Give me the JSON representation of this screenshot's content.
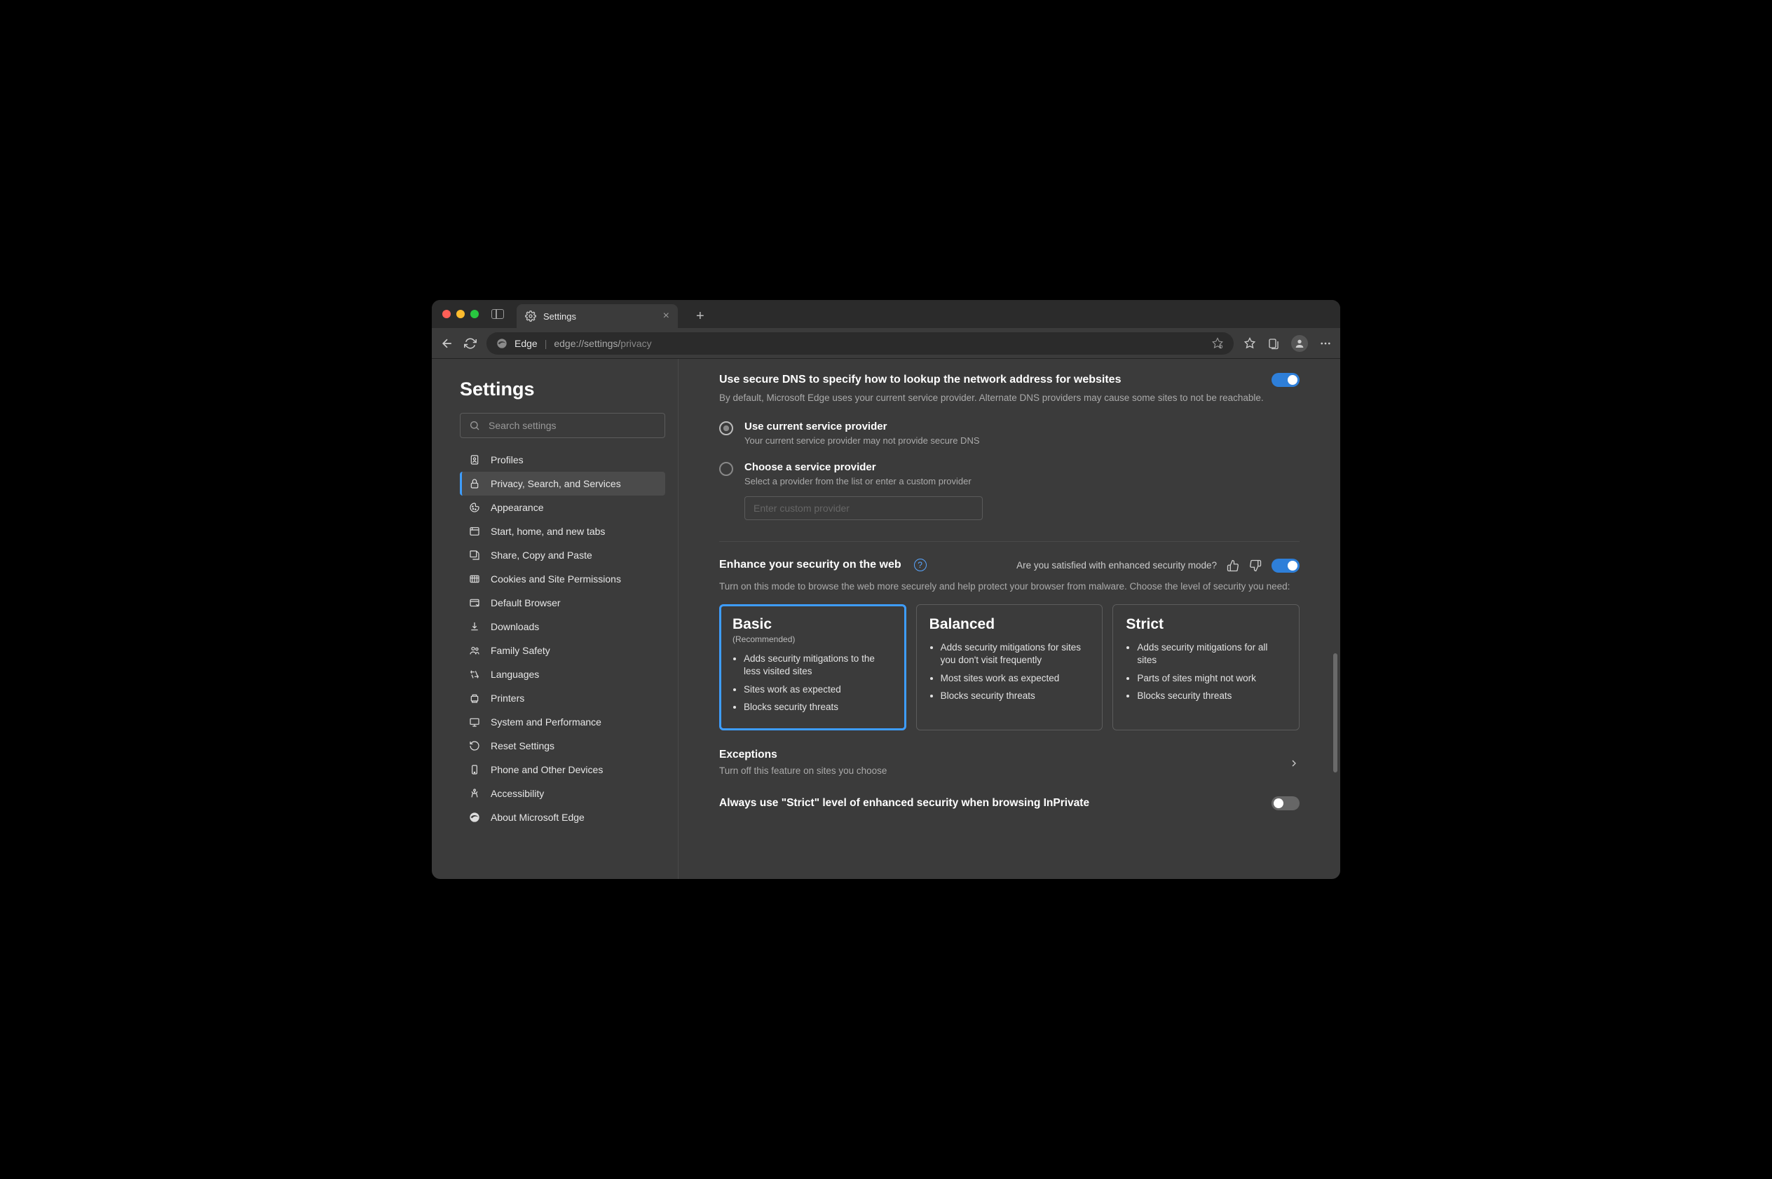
{
  "titlebar": {
    "tab_title": "Settings"
  },
  "toolbar": {
    "brand": "Edge",
    "url_pre": "edge://settings/",
    "url_suf": "privacy"
  },
  "sidebar": {
    "title": "Settings",
    "search_placeholder": "Search settings",
    "items": [
      {
        "label": "Profiles"
      },
      {
        "label": "Privacy, Search, and Services"
      },
      {
        "label": "Appearance"
      },
      {
        "label": "Start, home, and new tabs"
      },
      {
        "label": "Share, Copy and Paste"
      },
      {
        "label": "Cookies and Site Permissions"
      },
      {
        "label": "Default Browser"
      },
      {
        "label": "Downloads"
      },
      {
        "label": "Family Safety"
      },
      {
        "label": "Languages"
      },
      {
        "label": "Printers"
      },
      {
        "label": "System and Performance"
      },
      {
        "label": "Reset Settings"
      },
      {
        "label": "Phone and Other Devices"
      },
      {
        "label": "Accessibility"
      },
      {
        "label": "About Microsoft Edge"
      }
    ]
  },
  "dns": {
    "heading": "Use secure DNS to specify how to lookup the network address for websites",
    "sub": "By default, Microsoft Edge uses your current service provider. Alternate DNS providers may cause some sites to not be reachable.",
    "opt1": "Use current service provider",
    "opt1_sub": "Your current service provider may not provide secure DNS",
    "opt2": "Choose a service provider",
    "opt2_sub": "Select a provider from the list or enter a custom provider",
    "custom_placeholder": "Enter custom provider"
  },
  "enhance": {
    "heading": "Enhance your security on the web",
    "feedback_q": "Are you satisfied with enhanced security mode?",
    "sub": "Turn on this mode to browse the web more securely and help protect your browser from malware. Choose the level of security you need:",
    "cards": [
      {
        "title": "Basic",
        "rec": "(Recommended)",
        "bullets": [
          "Adds security mitigations to the less visited sites",
          "Sites work as expected",
          "Blocks security threats"
        ]
      },
      {
        "title": "Balanced",
        "bullets": [
          "Adds security mitigations for sites you don't visit frequently",
          "Most sites work as expected",
          "Blocks security threats"
        ]
      },
      {
        "title": "Strict",
        "bullets": [
          "Adds security mitigations for all sites",
          "Parts of sites might not work",
          "Blocks security threats"
        ]
      }
    ],
    "exceptions": "Exceptions",
    "exceptions_sub": "Turn off this feature on sites you choose",
    "inprivate": "Always use \"Strict\" level of enhanced security when browsing InPrivate"
  }
}
